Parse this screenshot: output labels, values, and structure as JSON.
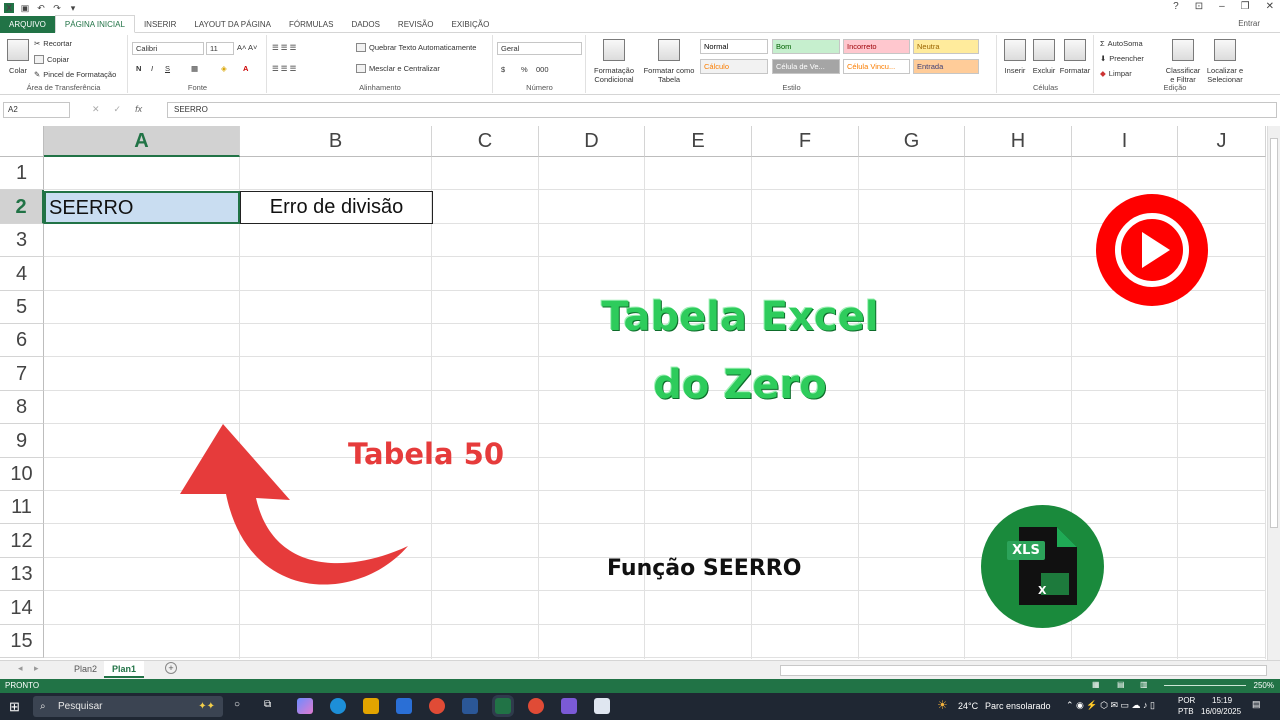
{
  "titlebar": {
    "app_icon": "X",
    "win_help": "?",
    "win_restore_ribbon": "⊡",
    "win_minimize": "–",
    "win_maximize": "❐",
    "win_close": "✕"
  },
  "tabs": {
    "file": "ARQUIVO",
    "home": "PÁGINA INICIAL",
    "insert": "INSERIR",
    "page_layout": "LAYOUT DA PÁGINA",
    "formulas": "FÓRMULAS",
    "data": "DADOS",
    "review": "REVISÃO",
    "view": "EXIBIÇÃO",
    "signin": "Entrar"
  },
  "ribbon": {
    "clipboard": {
      "paste": "Colar",
      "cut": "Recortar",
      "copy": "Copiar",
      "painter": "Pincel de Formatação",
      "label": "Área de Transferência"
    },
    "font": {
      "name": "Calibri",
      "size": "11",
      "bold": "N",
      "italic": "I",
      "underline": "S",
      "label": "Fonte"
    },
    "alignment": {
      "wrap": "Quebrar Texto Automaticamente",
      "merge": "Mesclar e Centralizar",
      "label": "Alinhamento"
    },
    "number": {
      "format": "Geral",
      "currency": "$",
      "percent": "%",
      "thousands": "000",
      "label": "Número"
    },
    "styles": {
      "conditional": "Formatação Condicional",
      "format_table": "Formatar como Tabela",
      "cells": [
        {
          "text": "Normal",
          "bg": "#ffffff",
          "fg": "#000000"
        },
        {
          "text": "Bom",
          "bg": "#c6efce",
          "fg": "#006100"
        },
        {
          "text": "Incorreto",
          "bg": "#ffc7ce",
          "fg": "#9c0006"
        },
        {
          "text": "Neutra",
          "bg": "#ffeb9c",
          "fg": "#9c6500"
        },
        {
          "text": "Cálculo",
          "bg": "#f2f2f2",
          "fg": "#fa7d00"
        },
        {
          "text": "Célula de Ve...",
          "bg": "#a5a5a5",
          "fg": "#ffffff"
        },
        {
          "text": "Célula Vincu...",
          "bg": "#ffffff",
          "fg": "#fa7d00"
        },
        {
          "text": "Entrada",
          "bg": "#ffcc99",
          "fg": "#3f3f76"
        }
      ],
      "label": "Estilo"
    },
    "cells": {
      "insert": "Inserir",
      "delete": "Excluir",
      "format": "Formatar",
      "label": "Células"
    },
    "editing": {
      "autosum": "AutoSoma",
      "fill": "Preencher",
      "clear": "Limpar",
      "sort": "Classificar e Filtrar",
      "find": "Localizar e Selecionar",
      "label": "Edição"
    }
  },
  "formula_bar": {
    "name_box": "A2",
    "cancel": "✕",
    "enter": "✓",
    "fx": "fx",
    "content": "SEERRO"
  },
  "grid": {
    "columns": [
      "A",
      "B",
      "C",
      "D",
      "E",
      "F",
      "G",
      "H",
      "I",
      "J"
    ],
    "rows": [
      "1",
      "2",
      "3",
      "4",
      "5",
      "6",
      "7",
      "8",
      "9",
      "10",
      "11",
      "12",
      "13",
      "14",
      "15"
    ],
    "selected_column": "A",
    "selected_row": "2",
    "a2": "SEERRO",
    "b2": "Erro de divisão"
  },
  "overlay": {
    "title_line1": "Tabela Excel",
    "title_line2": "do Zero",
    "tabela_label": "Tabela 50",
    "funcao_label": "Função SEERRO",
    "xls_badge": "XLS",
    "title_color": "#2ecc5c",
    "red_color": "#e63b3b"
  },
  "sheets": {
    "tabs": [
      "Plan2",
      "Plan1"
    ],
    "active": "Plan1",
    "add": "+"
  },
  "status": {
    "ready": "PRONTO",
    "zoom": "250%"
  },
  "taskbar": {
    "search": "Pesquisar",
    "temp": "24°C",
    "weather": "Parc ensolarado",
    "lang1": "POR",
    "lang2": "PTB",
    "time": "15:19",
    "date": "16/09/2025"
  }
}
